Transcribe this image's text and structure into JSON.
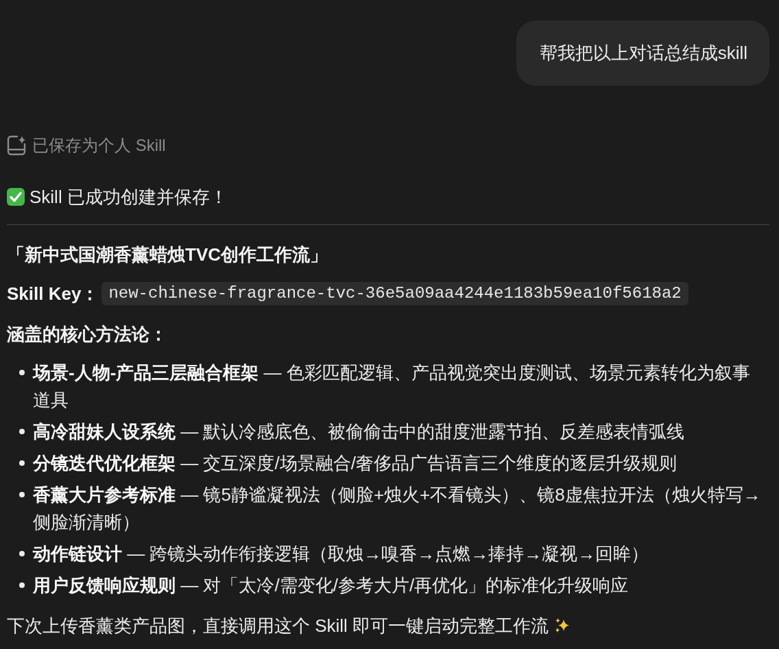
{
  "user_message": {
    "text": "帮我把以上对话总结成skill"
  },
  "saved_notice": {
    "text": "已保存为个人 Skill"
  },
  "status": {
    "text": "Skill 已成功创建并保存！"
  },
  "skill": {
    "title": "「新中式国潮香薰蜡烛TVC创作工作流」",
    "key_label": "Skill Key：",
    "key": "new-chinese-fragrance-tvc-36e5a09aa4244e1183b59ea10f5618a2"
  },
  "methods": {
    "heading": "涵盖的核心方法论：",
    "items": [
      {
        "text": "**场景-人物-产品三层融合框架** — 色彩匹配逻辑、产品视觉突出度测试、场景元素转化为叙事道具"
      },
      {
        "text": "**高冷甜妹人设系统** — 默认冷感底色、被偷偷击中的甜度泄露节拍、反差感表情弧线"
      },
      {
        "text": "**分镜迭代优化框架** — 交互深度/场景融合/奢侈品广告语言三个维度的逐层升级规则"
      },
      {
        "text": "**香薰大片参考标准** — 镜5静谧凝视法（侧脸+烛火+不看镜头）、镜8虚焦拉开法（烛火特写→侧脸渐清晰）"
      },
      {
        "text": "**动作链设计** — 跨镜头动作衔接逻辑（取烛→嗅香→点燃→捧持→凝视→回眸）"
      },
      {
        "text": "**用户反馈响应规则** — 对「太冷/需变化/参考大片/再优化」的标准化升级响应"
      }
    ]
  },
  "footer": {
    "text": "下次上传香薰类产品图，直接调用这个 Skill 即可一键启动完整工作流"
  }
}
